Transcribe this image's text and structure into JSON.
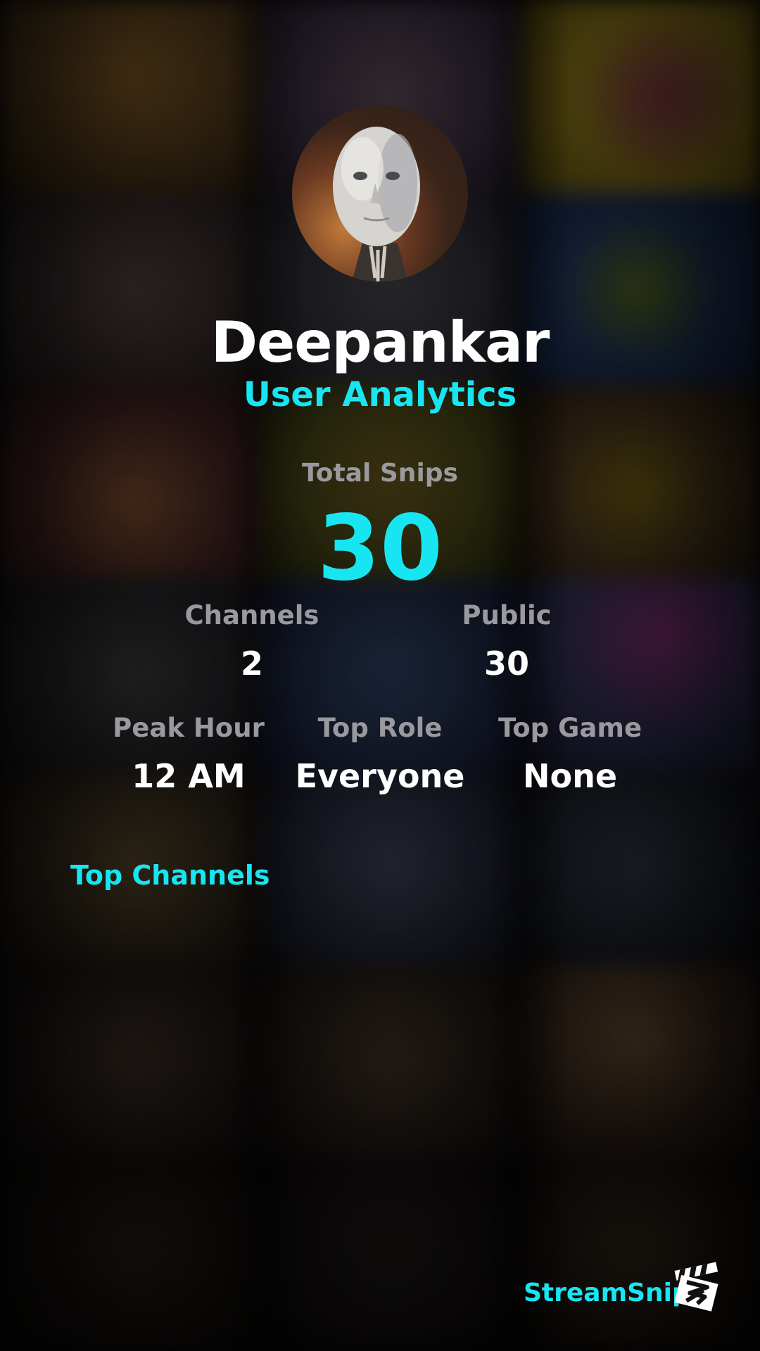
{
  "profile": {
    "username": "Deepankar",
    "subtitle": "User Analytics",
    "avatar_icon": "robot-avatar"
  },
  "summary": {
    "total_label": "Total Snips",
    "total_value": "30"
  },
  "stats_row1": [
    {
      "label": "Channels",
      "value": "2"
    },
    {
      "label": "Public",
      "value": "30"
    }
  ],
  "stats_row2": [
    {
      "label": "Peak Hour",
      "value": "12 AM"
    },
    {
      "label": "Top Role",
      "value": "Everyone"
    },
    {
      "label": "Top Game",
      "value": "None"
    }
  ],
  "sections": {
    "top_channels": "Top Channels"
  },
  "footer": {
    "brand": "StreamSnip",
    "logo_icon": "clapperboard-icon"
  },
  "colors": {
    "accent": "#17e6f2",
    "label_gray": "#9a9a9e",
    "text_white": "#ffffff",
    "background": "#050506"
  }
}
